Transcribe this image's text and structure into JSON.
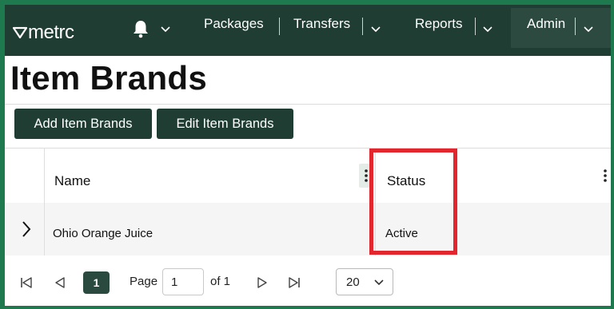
{
  "nav": {
    "logo_text": "metrc",
    "links": [
      "Packages",
      "Transfers",
      "Reports",
      "Admin"
    ]
  },
  "page": {
    "title": "Item Brands"
  },
  "toolbar": {
    "add_label": "Add Item Brands",
    "edit_label": "Edit Item Brands"
  },
  "grid": {
    "columns": [
      "Name",
      "Status"
    ],
    "rows": [
      {
        "name": "Ohio Orange Juice",
        "status": "Active"
      }
    ]
  },
  "pager": {
    "current_page": "1",
    "page_label": "Page",
    "page_input_value": "1",
    "of_label": "of 1",
    "page_size": "20"
  },
  "colors": {
    "nav_bg": "#1f3d33",
    "button_bg": "#1f3d33",
    "frame_green": "#1e7a4e",
    "highlight_red": "#e3262d"
  },
  "icons": [
    "metrc-logo-icon",
    "bell-icon",
    "chevron-down-icon",
    "column-menu-icon",
    "expand-row-icon",
    "first-page-icon",
    "prev-page-icon",
    "next-page-icon",
    "last-page-icon"
  ]
}
